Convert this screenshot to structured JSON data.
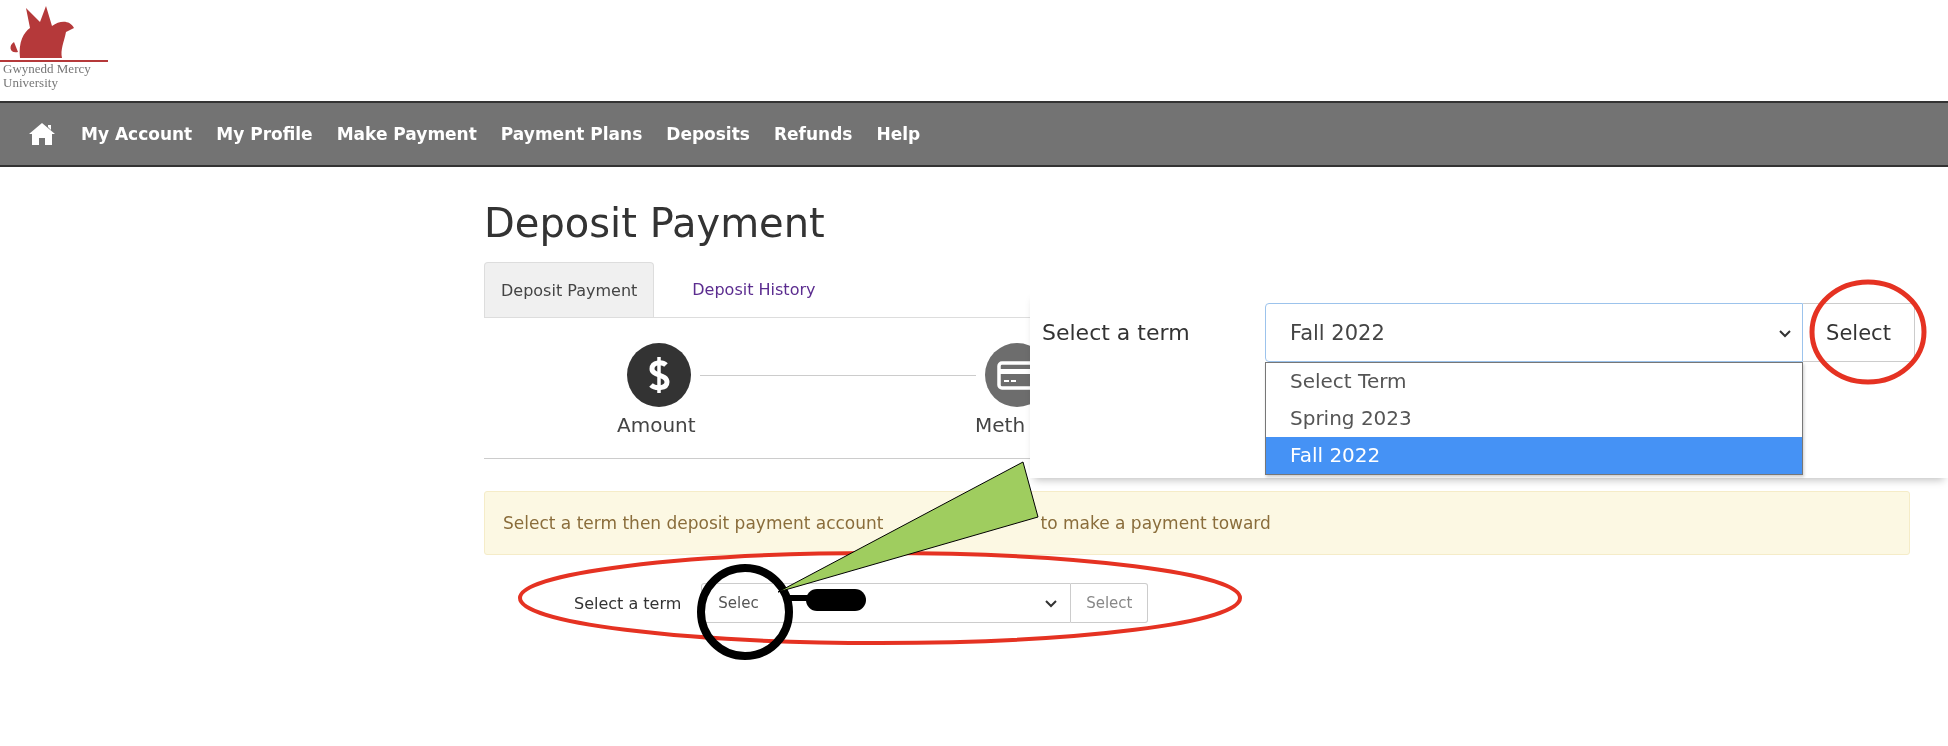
{
  "logo": {
    "lines": [
      "Gwynedd Mercy",
      "University"
    ]
  },
  "nav": {
    "items": [
      {
        "label": "My Account"
      },
      {
        "label": "My Profile"
      },
      {
        "label": "Make Payment"
      },
      {
        "label": "Payment Plans"
      },
      {
        "label": "Deposits"
      },
      {
        "label": "Refunds"
      },
      {
        "label": "Help"
      }
    ]
  },
  "page_title": "Deposit Payment",
  "tabs": [
    {
      "label": "Deposit Payment",
      "selected": true
    },
    {
      "label": "Deposit History",
      "selected": false
    }
  ],
  "steps": [
    {
      "label": "Amount",
      "kind": "dollar",
      "active": true
    },
    {
      "label": "Meth",
      "kind": "card",
      "active": false
    }
  ],
  "alert": {
    "text_before": "Select a term then deposit payment account",
    "text_after": "to make a payment toward"
  },
  "term_form": {
    "label": "Select a term",
    "value": "Selec",
    "button": "Select"
  },
  "zoom_inset": {
    "label": "Select a term",
    "value": "Fall 2022",
    "button": "Select",
    "options": [
      {
        "label": "Select Term",
        "selected": false
      },
      {
        "label": "Spring 2023",
        "selected": false
      },
      {
        "label": "Fall 2022",
        "selected": true
      }
    ]
  }
}
